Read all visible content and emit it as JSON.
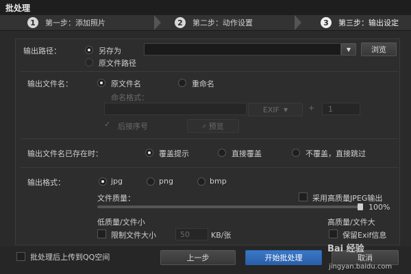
{
  "window": {
    "title": "批处理"
  },
  "steps": [
    {
      "num": "1",
      "label": "第一步：添加照片"
    },
    {
      "num": "2",
      "label": "第二步：动作设置"
    },
    {
      "num": "3",
      "label": "第三步：输出设定"
    }
  ],
  "output_path": {
    "label": "输出路径：",
    "option_save_as": "另存为",
    "option_original": "原文件路径",
    "path_value": "",
    "browse": "浏览"
  },
  "output_name": {
    "label": "输出文件名：",
    "option_original": "原文件名",
    "option_rename": "重命名",
    "format_label": "命名格式：",
    "exif": "EXIF",
    "plus": "+",
    "seq_start": "1",
    "after_seq": "后接序号",
    "preview": "预览"
  },
  "exists": {
    "label": "输出文件名已存在时：",
    "option_prompt": "覆盖提示",
    "option_overwrite": "直接覆盖",
    "option_skip": "不覆盖，直接跳过"
  },
  "format": {
    "label": "输出格式：",
    "option_jpg": "jpg",
    "option_png": "png",
    "option_bmp": "bmp",
    "quality_label": "文件质量：",
    "high_quality_jpeg": "采用高质量JPEG输出",
    "quality_percent": "100%",
    "quality_value": 1.0,
    "low_quality": "低质量/文件小",
    "high_quality": "高质量/文件大",
    "limit_size": "限制文件大小",
    "limit_value": "50",
    "unit": "KB/张",
    "keep_exif": "保留Exif信息"
  },
  "footer": {
    "upload_qq": "批处理后上传到QQ空间",
    "prev": "上一步",
    "start": "开始批处理",
    "cancel": "取消"
  },
  "watermark": {
    "brand": "Bai 经验",
    "url": "jingyan.baidu.com"
  }
}
